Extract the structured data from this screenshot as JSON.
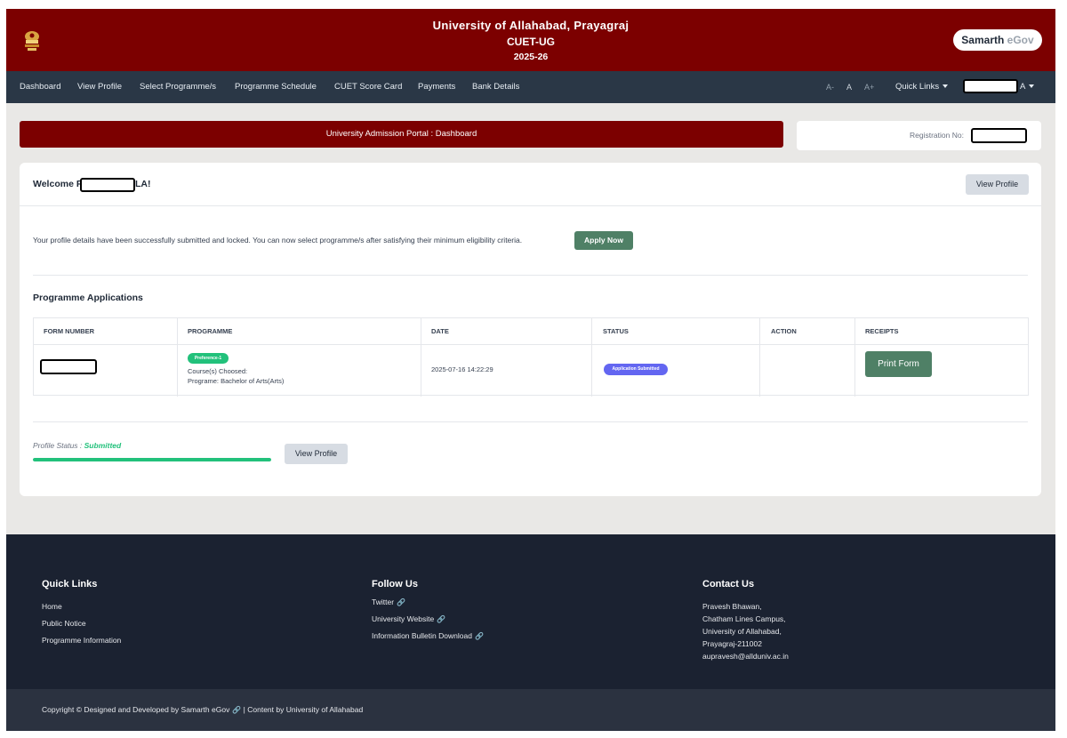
{
  "header": {
    "university": "University of Allahabad, Prayagraj",
    "exam": "CUET-UG",
    "year": "2025-26",
    "brand_main": "Samarth",
    "brand_accent": "eGov"
  },
  "nav": {
    "items": [
      "Dashboard",
      "View Profile",
      "Select Programme/s",
      "Programme Schedule",
      "CUET Score Card",
      "Payments",
      "Bank Details"
    ],
    "font_controls": [
      "A-",
      "A",
      "A+"
    ],
    "quick_links": "Quick Links",
    "user_suffix": "A"
  },
  "title_bar": "University Admission Portal : Dashboard",
  "registration_label": "Registration No:",
  "welcome": {
    "prefix": "Welcome P",
    "suffix": "LA!"
  },
  "view_profile_label": "View Profile",
  "info_message": "Your profile details have been successfully submitted and locked. You can now select programme/s after satisfying their minimum eligibility criteria.",
  "apply_now_label": "Apply Now",
  "applications": {
    "title": "Programme Applications",
    "columns": [
      "FORM NUMBER",
      "PROGRAMME",
      "DATE",
      "STATUS",
      "ACTION",
      "RECEIPTS"
    ],
    "rows": [
      {
        "preference": "Preference-1",
        "courses_label": "Course(s) Choosed:",
        "programme": "Programe: Bachelor of Arts(Arts)",
        "date": "2025-07-16 14:22:29",
        "status": "Application Submitted",
        "receipt_label": "Print Form"
      }
    ]
  },
  "profile_status": {
    "label": "Profile Status : ",
    "value": "Submitted",
    "progress_percent": 100
  },
  "footer": {
    "quick_links": {
      "title": "Quick Links",
      "items": [
        "Home",
        "Public Notice",
        "Programme Information"
      ]
    },
    "follow_us": {
      "title": "Follow Us",
      "items": [
        "Twitter",
        "University Website",
        "Information Bulletin Download"
      ]
    },
    "contact": {
      "title": "Contact Us",
      "lines": [
        "Pravesh Bhawan,",
        "Chatham Lines Campus,",
        "University of Allahabad,",
        "Prayagraj-211002",
        "aupravesh@allduniv.ac.in"
      ]
    },
    "copyright_part1": "Copyright © Designed and Developed by Samarth eGov",
    "copyright_part2": "| Content by University of Allahabad"
  },
  "colors": {
    "header": "#7c0000",
    "nav": "#2a3746",
    "footer": "#1b2231",
    "success": "#22c17b",
    "button_green": "#4f8066",
    "status_badge": "#6366f1"
  }
}
